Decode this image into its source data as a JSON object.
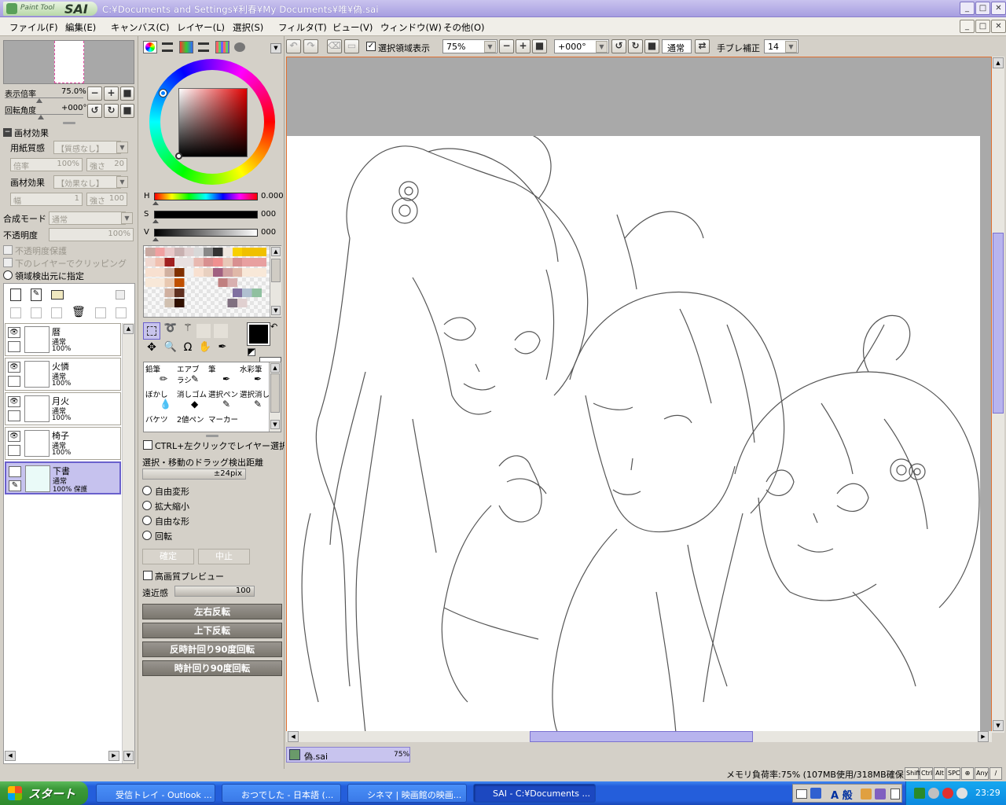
{
  "app": {
    "logo_text": "Paint Tool",
    "logo_brand": "SAI",
    "title": "C:¥Documents and Settings¥利春¥My Documents¥唯¥偽.sai"
  },
  "menu": [
    "ファイル(F)",
    "編集(E)",
    "キャンバス(C)",
    "レイヤー(L)",
    "選択(S)",
    "フィルタ(T)",
    "ビュー(V)",
    "ウィンドウ(W)",
    "その他(O)"
  ],
  "navigator": {
    "zoom_label": "表示倍率",
    "zoom_value": "75.0%",
    "rotate_label": "回転角度",
    "rotate_value": "+000°"
  },
  "material": {
    "header": "画材効果",
    "paper_label": "用紙質感",
    "paper_value": "【質感なし】",
    "paper_scale_label": "倍率",
    "paper_scale_value": "100%",
    "paper_strength_label": "強さ",
    "paper_strength_value": "20",
    "effect_label": "画材効果",
    "effect_value": "【効果なし】",
    "effect_width_label": "幅",
    "effect_width_value": "1",
    "effect_strength_label": "強さ",
    "effect_strength_value": "100"
  },
  "layer_props": {
    "blend_label": "合成モード",
    "blend_value": "通常",
    "opacity_label": "不透明度",
    "opacity_value": "100%",
    "protect_opacity": "不透明度保護",
    "clip_lower": "下のレイヤーでクリッピング",
    "detect_source": "領域検出元に指定"
  },
  "layers": [
    {
      "name": "暦",
      "mode": "通常",
      "opacity": "100%"
    },
    {
      "name": "火憐",
      "mode": "通常",
      "opacity": "100%"
    },
    {
      "name": "月火",
      "mode": "通常",
      "opacity": "100%"
    },
    {
      "name": "椅子",
      "mode": "通常",
      "opacity": "100%"
    },
    {
      "name": "下書",
      "mode": "通常",
      "opacity": "100% 保護"
    }
  ],
  "color": {
    "h_label": "H",
    "h_value": "0.000",
    "s_label": "S",
    "s_value": "000",
    "v_label": "V",
    "v_value": "000",
    "foreground": "#000000",
    "background": "#ffffff"
  },
  "brushes": [
    [
      "鉛筆",
      "エアブラシ",
      "筆",
      "水彩筆"
    ],
    [
      "ぼかし",
      "消しゴム",
      "選択ペン",
      "選択消し"
    ],
    [
      "バケツ",
      "2値ペン",
      "マーカー",
      ""
    ]
  ],
  "transform": {
    "ctrl_select": "CTRL+左クリックでレイヤー選択",
    "drag_detect": "選択・移動のドラッグ検出距離",
    "drag_value": "±24pix",
    "options": [
      "自由変形",
      "拡大縮小",
      "自由な形",
      "回転"
    ],
    "ok": "確定",
    "cancel": "中止",
    "hq_preview": "高画質プレビュー",
    "perspective_label": "遠近感",
    "perspective_value": "100",
    "flip_h": "左右反転",
    "flip_v": "上下反転",
    "rot_ccw": "反時計回り90度回転",
    "rot_cw": "時計回り90度回転"
  },
  "toolbar": {
    "show_selection": "選択領域表示",
    "zoom": "75%",
    "angle": "+000°",
    "mode": "通常",
    "stabilizer_label": "手ブレ補正",
    "stabilizer_value": "14"
  },
  "docs": [
    {
      "name": "偽.sai",
      "zoom": "75%"
    }
  ],
  "status": {
    "memory": "メモリ負荷率:75% (107MB使用/318MB確保)",
    "keys": [
      "Shift",
      "Ctrl",
      "Alt",
      "SPC",
      "⊕",
      "Any",
      "/"
    ]
  },
  "taskbar": {
    "start": "スタート",
    "tasks": [
      "受信トレイ - Outlook ...",
      "おつでした - 日本語 (...",
      "シネマ | 映画館の映画...",
      "SAI - C:¥Documents ..."
    ],
    "ime": "A 般",
    "clock": "23:29"
  }
}
